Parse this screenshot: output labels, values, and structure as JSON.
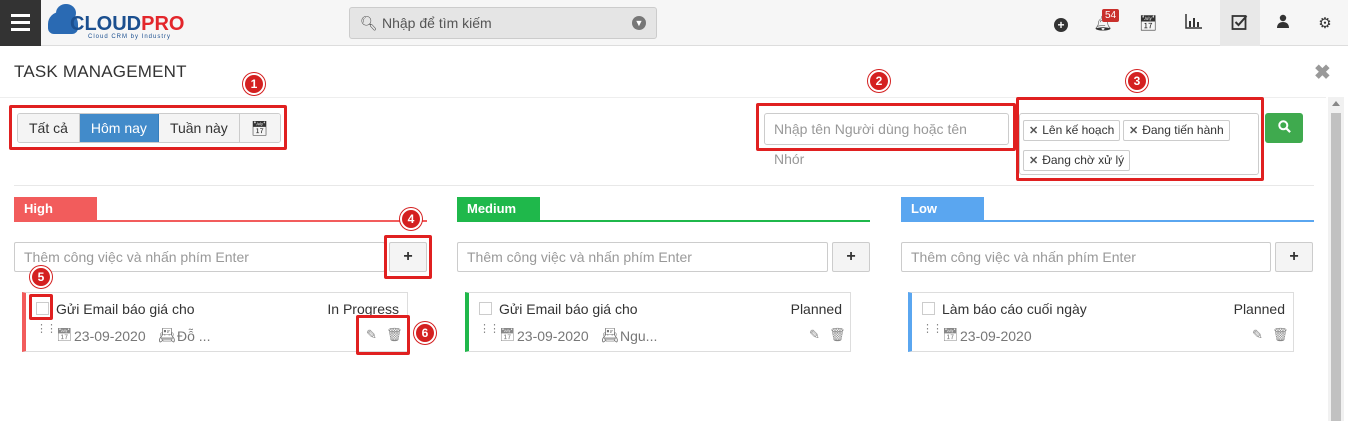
{
  "topbar": {
    "logo_cloud": "CLOUD",
    "logo_pro": "PRO",
    "logo_tagline": "Cloud CRM by Industry",
    "search_placeholder": "Nhập để tìm kiếm",
    "notification_count": "54",
    "icons": [
      "plus-circle-icon",
      "bell-icon",
      "calendar-icon",
      "bar-chart-icon",
      "checkbox-icon",
      "user-icon",
      "gear-icon"
    ]
  },
  "page": {
    "title": "TASK MANAGEMENT"
  },
  "filters": {
    "buttons": [
      "Tất cả",
      "Hôm nay",
      "Tuần này"
    ],
    "active": "Hôm nay"
  },
  "search": {
    "user_placeholder": "Nhập tên Người dùng hoặc tên Nhóm",
    "user_visible_placeholder": "Nhập tên Người dùng hoặc tên Nhór",
    "status_tags": [
      "Lên kế hoạch",
      "Đang tiến hành",
      "Đang chờ xử lý"
    ]
  },
  "columns": [
    {
      "label": "High",
      "color": "#f25c5c",
      "add_placeholder": "Thêm công việc và nhấn phím Enter",
      "card": {
        "title": "Gửi Email báo giá cho",
        "status": "In Progress",
        "date": "23-09-2020",
        "user": "Đỗ ..."
      }
    },
    {
      "label": "Medium",
      "color": "#1fb84b",
      "add_placeholder": "Thêm công việc và nhấn phím Enter",
      "card": {
        "title": "Gửi Email báo giá cho",
        "status": "Planned",
        "date": "23-09-2020",
        "user": "Ngu..."
      }
    },
    {
      "label": "Low",
      "color": "#5aa6f0",
      "add_placeholder": "Thêm công việc và nhấn phím Enter",
      "card": {
        "title": "Làm báo cáo cuối ngày",
        "status": "Planned",
        "date": "23-09-2020",
        "user": ""
      }
    }
  ],
  "annotations": [
    "1",
    "2",
    "3",
    "4",
    "5",
    "6"
  ],
  "annotation_color": "#e02020"
}
